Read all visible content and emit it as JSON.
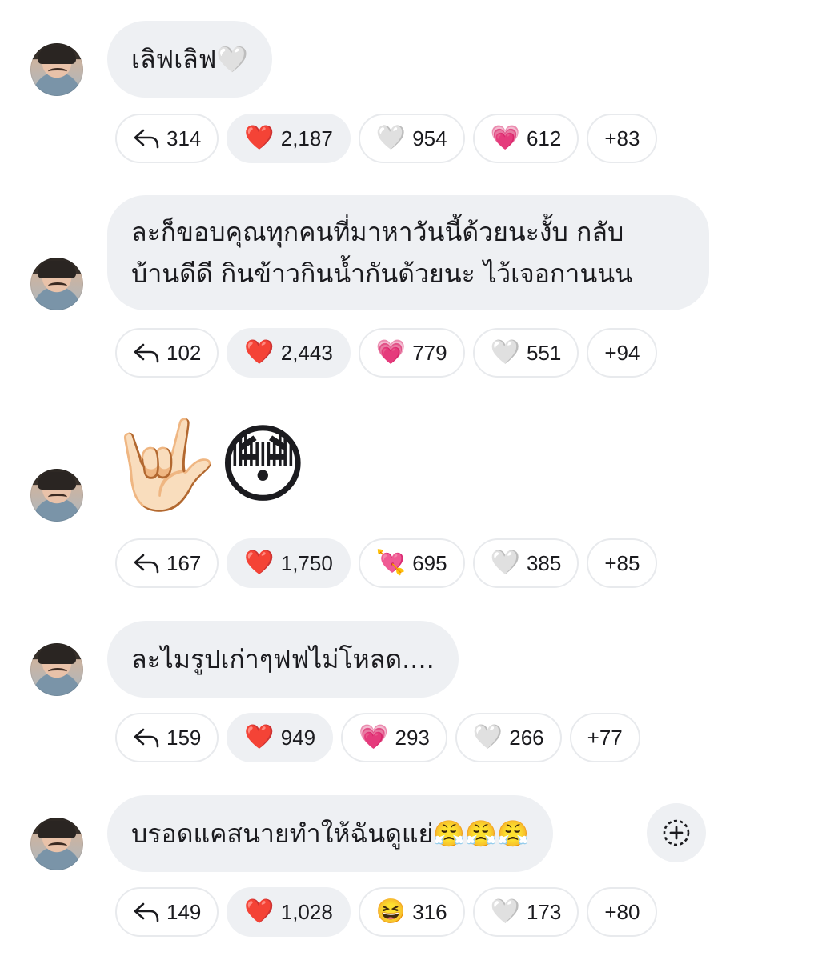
{
  "messages": [
    {
      "text_lines": [
        "เลิฟเลิฟ🤍"
      ],
      "reactions": {
        "reply_count": "314",
        "r1": {
          "emoji": "❤️",
          "count": "2,187"
        },
        "r2": {
          "emoji": "🤍",
          "count": "954"
        },
        "r3": {
          "emoji": "💗",
          "count": "612"
        },
        "more": "+83"
      }
    },
    {
      "text_lines": [
        "ละก็ขอบคุณทุกคนที่มาหาวันนี้ด้วยนะงั้บ กลับ",
        "บ้านดีดี กินข้าวกินน้ำกันด้วยนะ ไว้เจอกานนน"
      ],
      "reactions": {
        "reply_count": "102",
        "r1": {
          "emoji": "❤️",
          "count": "2,443"
        },
        "r2": {
          "emoji": "💗",
          "count": "779"
        },
        "r3": {
          "emoji": "🤍",
          "count": "551"
        },
        "more": "+94"
      }
    },
    {
      "emoji_message": [
        "🤟🏻",
        "😳"
      ],
      "reactions": {
        "reply_count": "167",
        "r1": {
          "emoji": "❤️",
          "count": "1,750"
        },
        "r2": {
          "emoji": "💘",
          "count": "695"
        },
        "r3": {
          "emoji": "🤍",
          "count": "385"
        },
        "more": "+85"
      }
    },
    {
      "text_lines": [
        "ละไมรูปเก่าๆฟฟไม่โหลด...."
      ],
      "reactions": {
        "reply_count": "159",
        "r1": {
          "emoji": "❤️",
          "count": "949"
        },
        "r2": {
          "emoji": "💗",
          "count": "293"
        },
        "r3": {
          "emoji": "🤍",
          "count": "266"
        },
        "more": "+77"
      }
    },
    {
      "text_lines": [
        "บรอดแคสนายทำให้ฉันดูแย่😤😤😤"
      ],
      "reactions": {
        "reply_count": "149",
        "r1": {
          "emoji": "❤️",
          "count": "1,028"
        },
        "r2": {
          "emoji": "😆",
          "count": "316"
        },
        "r3": {
          "emoji": "🤍",
          "count": "173"
        },
        "more": "+80"
      }
    }
  ],
  "icons": {
    "reply": "reply-arrow-icon",
    "add_reaction": "add-reaction-icon"
  }
}
